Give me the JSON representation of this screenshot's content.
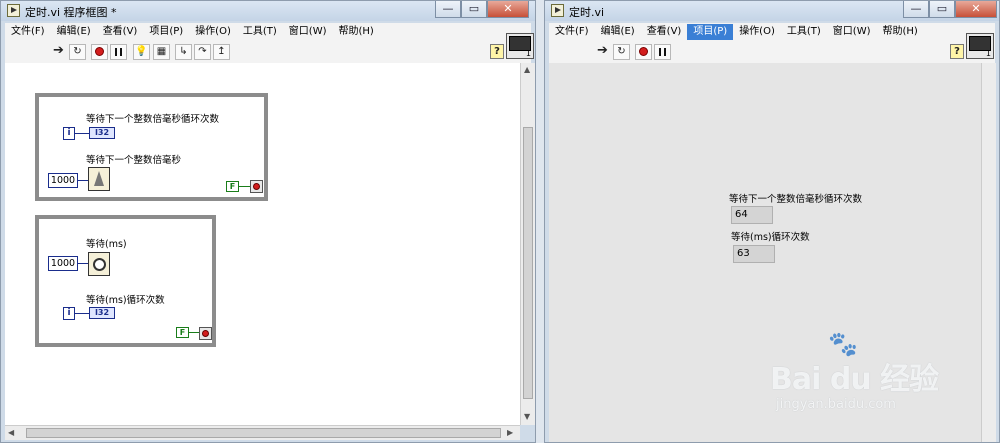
{
  "block_diagram_window": {
    "title": "定时.vi 程序框图 *",
    "window_buttons": {
      "minimize": "—",
      "restore": "▭",
      "close": "✕"
    },
    "menu": [
      "文件(F)",
      "编辑(E)",
      "查看(V)",
      "项目(P)",
      "操作(O)",
      "工具(T)",
      "窗口(W)",
      "帮助(H)"
    ],
    "toolbar": {
      "help_label": "?"
    },
    "loop1": {
      "label_iterations": "等待下一个整数倍毫秒循环次数",
      "iteration_terminal": "i",
      "indicator_type": "I32",
      "label_wait": "等待下一个整数倍毫秒",
      "wait_constant": "1000",
      "stop_constant": "F"
    },
    "loop2": {
      "label_wait": "等待(ms)",
      "wait_constant": "1000",
      "label_iterations": "等待(ms)循环次数",
      "iteration_terminal": "i",
      "indicator_type": "I32",
      "stop_constant": "F"
    }
  },
  "front_panel_window": {
    "title": "定时.vi",
    "window_buttons": {
      "minimize": "—",
      "restore": "▭",
      "close": "✕"
    },
    "menu": [
      "文件(F)",
      "编辑(E)",
      "查看(V)",
      "项目(P)",
      "操作(O)",
      "工具(T)",
      "窗口(W)",
      "帮助(H)"
    ],
    "active_menu": "项目(P)",
    "toolbar": {
      "help_label": "?"
    },
    "indicators": [
      {
        "label": "等待下一个整数倍毫秒循环次数",
        "value": "64"
      },
      {
        "label": "等待(ms)循环次数",
        "value": "63"
      }
    ]
  },
  "watermark": {
    "logo": "Bai du 经验",
    "sub": "jingyan.baidu.com"
  },
  "colors": {
    "menu_highlight": "#3a7fd5",
    "integer_wire": "#1a2d8c",
    "boolean_wire": "#1a7d1a",
    "stop_red": "#d31d1d",
    "loop_border": "#8c8c8c"
  }
}
